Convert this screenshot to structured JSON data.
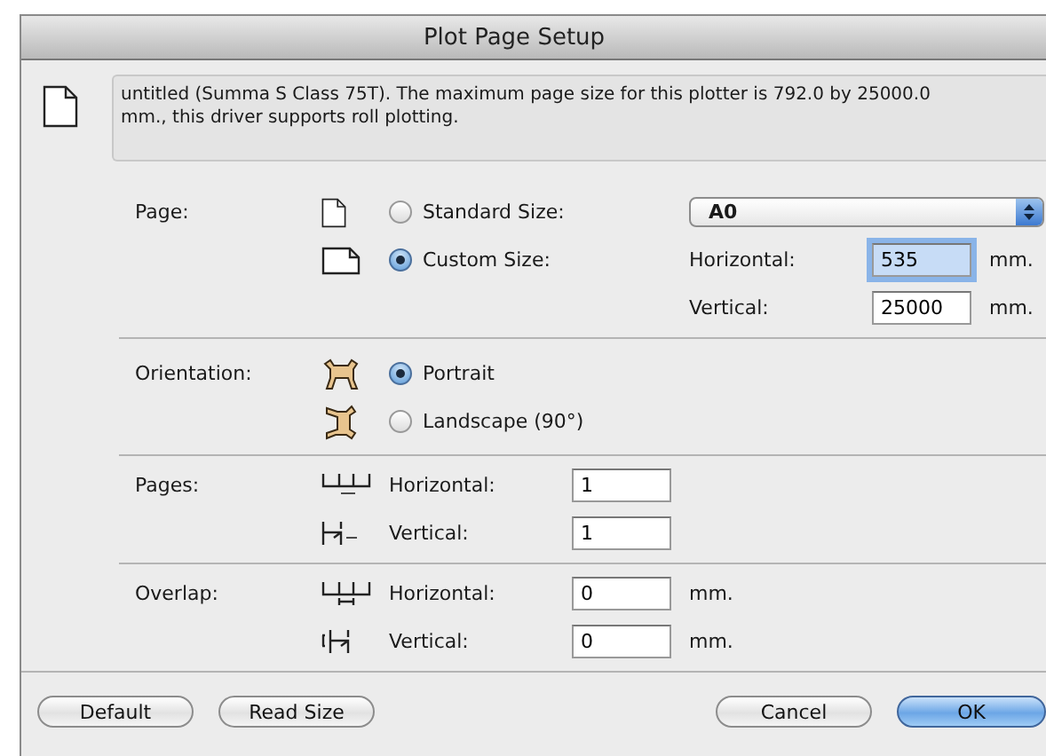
{
  "window": {
    "title": "Plot Page Setup"
  },
  "info": "untitled (Summa S Class 75T). The maximum page size for this plotter is 792.0 by 25000.0 mm., this driver supports roll plotting.",
  "page": {
    "label": "Page:",
    "options": [
      {
        "label": "Standard Size:",
        "selected": false,
        "kind": "portrait"
      },
      {
        "label": "Custom Size:",
        "selected": true,
        "kind": "landscape"
      }
    ],
    "paper_size": "A0",
    "custom_fields": [
      {
        "label": "Horizontal:",
        "value": "535",
        "unit": "mm.",
        "focused": true
      },
      {
        "label": "Vertical:",
        "value": "25000",
        "unit": "mm.",
        "focused": false
      }
    ]
  },
  "orientation": {
    "label": "Orientation:",
    "options": [
      {
        "label": "Portrait",
        "selected": true,
        "kind": "portrait"
      },
      {
        "label": "Landscape (90°)",
        "selected": false,
        "kind": "landscape"
      }
    ]
  },
  "pages": {
    "label": "Pages:",
    "fields": [
      {
        "label": "Horizontal:",
        "value": "1",
        "kind": "horizontal"
      },
      {
        "label": "Vertical:",
        "value": "1",
        "kind": "vertical"
      }
    ]
  },
  "overlap": {
    "label": "Overlap:",
    "fields": [
      {
        "label": "Horizontal:",
        "value": "0",
        "unit": "mm.",
        "kind": "horizontal"
      },
      {
        "label": "Vertical:",
        "value": "0",
        "unit": "mm.",
        "kind": "vertical"
      }
    ]
  },
  "left_buttons": [
    {
      "label": "Default",
      "default": false
    },
    {
      "label": "Read Size",
      "default": false
    }
  ],
  "right_buttons": [
    {
      "label": "Cancel",
      "default": false
    },
    {
      "label": "OK",
      "default": true
    }
  ]
}
